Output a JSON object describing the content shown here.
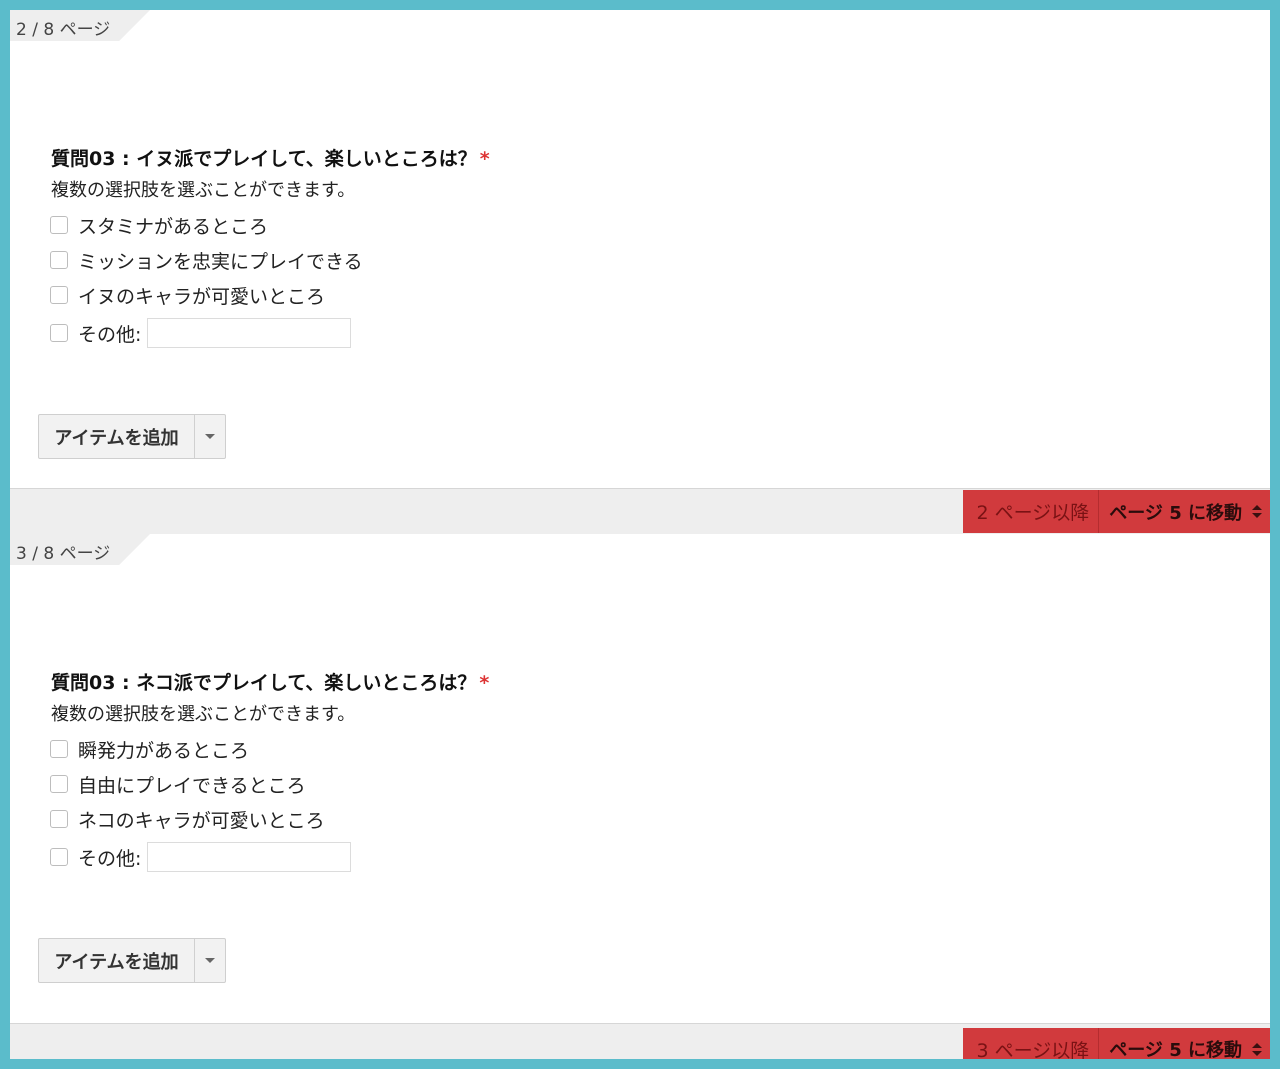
{
  "pages": [
    {
      "page_label": "2 / 8 ページ",
      "question_title": "質問03 : イヌ派でプレイして、楽しいところは？",
      "required_mark": "*",
      "help_text": "複数の選択肢を選ぶことができます。",
      "options": [
        "スタミナがあるところ",
        "ミッションを忠実にプレイできる",
        "イヌのキャラが可愛いところ"
      ],
      "other_label": "その他:",
      "other_value": "",
      "add_item_label": "アイテムを追加",
      "after_page_label": "2 ページ以降",
      "goto_label": "ページ 5 に移動"
    },
    {
      "page_label": "3 / 8 ページ",
      "question_title": "質問03 : ネコ派でプレイして、楽しいところは？",
      "required_mark": "*",
      "help_text": "複数の選択肢を選ぶことができます。",
      "options": [
        "瞬発力があるところ",
        "自由にプレイできるところ",
        "ネコのキャラが可愛いところ"
      ],
      "other_label": "その他:",
      "other_value": "",
      "add_item_label": "アイテムを追加",
      "after_page_label": "3 ページ以降",
      "goto_label": "ページ 5 に移動"
    }
  ],
  "colors": {
    "frame_border": "#5bbccb",
    "nav_box": "#d13a3d",
    "required_star": "#dd3333"
  }
}
